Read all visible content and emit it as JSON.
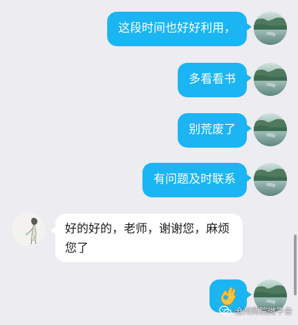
{
  "messages": [
    {
      "side": "out",
      "text": "这段时间也好好利用，"
    },
    {
      "side": "out",
      "text": "多看看书"
    },
    {
      "side": "out",
      "text": "别荒废了"
    },
    {
      "side": "out",
      "text": "有问题及时联系"
    },
    {
      "side": "in",
      "text": "好的好的，老师，谢谢您，麻烦您了"
    },
    {
      "side": "out",
      "emoji": "👌"
    }
  ],
  "watermark": {
    "text": "沧州师院微平台",
    "icon": "wechat-icon"
  },
  "colors": {
    "background": "#ececf1",
    "outgoing_bubble": "#1ab5f2",
    "incoming_bubble": "#ffffff"
  }
}
